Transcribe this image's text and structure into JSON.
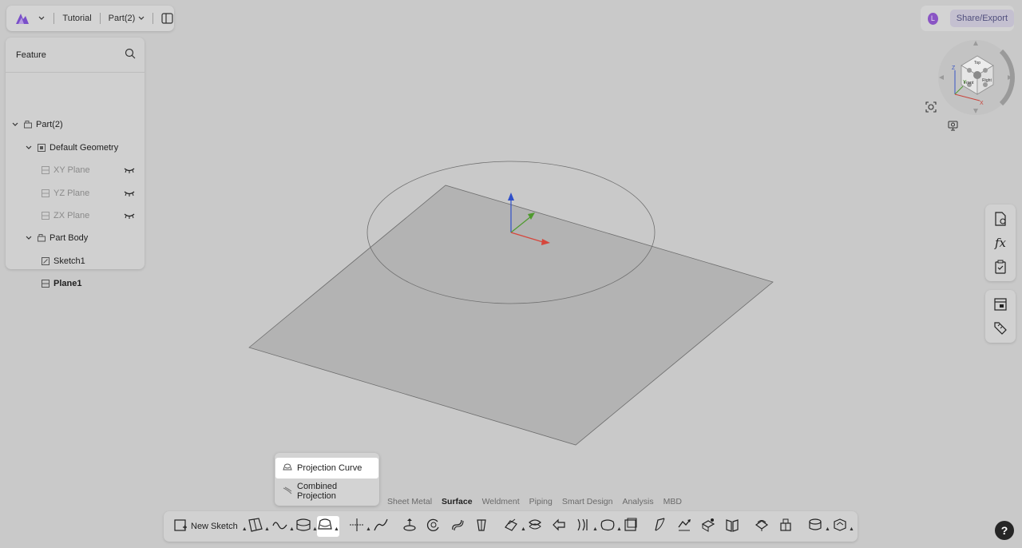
{
  "topbar": {
    "logo_icon": "app-logo-icon",
    "project": "Tutorial",
    "part": "Part(2)"
  },
  "sidebar": {
    "title": "Feature",
    "tree": [
      {
        "label": "Part(2)",
        "icon": "part-icon"
      },
      {
        "label": "Default Geometry",
        "icon": "geometry-icon"
      },
      {
        "label": "XY Plane",
        "icon": "plane-icon",
        "hidden": true
      },
      {
        "label": "YZ Plane",
        "icon": "plane-icon",
        "hidden": true
      },
      {
        "label": "ZX Plane",
        "icon": "plane-icon",
        "hidden": true
      },
      {
        "label": "Part Body",
        "icon": "body-icon"
      },
      {
        "label": "Sketch1",
        "icon": "sketch-icon"
      },
      {
        "label": "Plane1",
        "icon": "plane-icon",
        "bold": true
      }
    ]
  },
  "share": {
    "avatar_letter": "L",
    "label": "Share/Export"
  },
  "navcube": {
    "faces": [
      "Top",
      "Front",
      "Right"
    ],
    "axes": [
      "Z",
      "Y",
      "X"
    ]
  },
  "popup": {
    "items": [
      {
        "label": "Projection Curve",
        "active": true
      },
      {
        "label": "Combined Projection",
        "active": false
      }
    ]
  },
  "tabs": [
    "Sheet Metal",
    "Surface",
    "Weldment",
    "Piping",
    "Smart Design",
    "Analysis",
    "MBD"
  ],
  "selected_tab": "Surface",
  "toolbar": {
    "new_sketch": "New Sketch"
  },
  "help": "?",
  "colors": {
    "background": "#c9c9c9",
    "accent_purple": "#8a55c4",
    "axis_x": "#d6463c",
    "axis_y": "#4f9a2e",
    "axis_z": "#2f4fc9"
  }
}
